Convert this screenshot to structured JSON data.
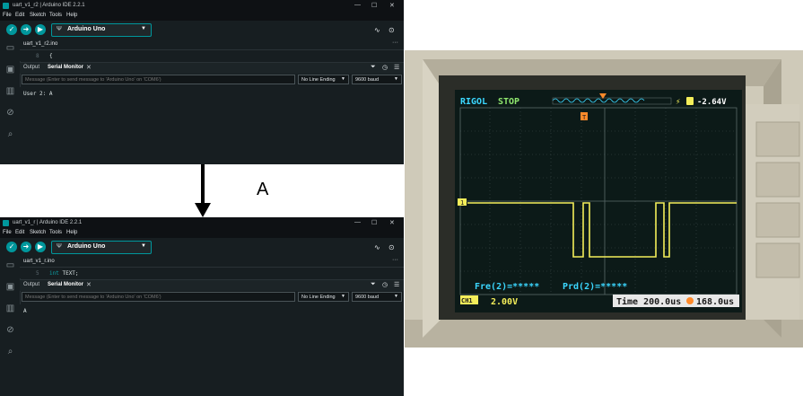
{
  "ide_top": {
    "title": "uart_v1_r2 | Arduino IDE 2.2.1",
    "menu": [
      "File",
      "Edit",
      "Sketch",
      "Tools",
      "Help"
    ],
    "board": "Arduino Uno",
    "file_tab": "uart_v1_r2.ino",
    "line_number": "8",
    "code": "{",
    "panel_tabs": [
      "Output",
      "Serial Monitor"
    ],
    "message_placeholder": "Message (Enter to send message to 'Arduino Uno' on 'COM6')",
    "line_ending": "No Line Ending",
    "baud": "9600 baud",
    "output": "User 2: A"
  },
  "ide_bottom": {
    "title": "uart_v1_r | Arduino IDE 2.2.1",
    "menu": [
      "File",
      "Edit",
      "Sketch",
      "Tools",
      "Help"
    ],
    "board": "Arduino Uno",
    "file_tab": "uart_v1_r.ino",
    "line_number": "5",
    "code_kw": "int",
    "code": "TEXT;",
    "panel_tabs": [
      "Output",
      "Serial Monitor"
    ],
    "message_placeholder": "Message (Enter to send message to 'Arduino Uno' on 'COM6')",
    "line_ending": "No Line Ending",
    "baud": "9600 baud",
    "output": "A"
  },
  "arrow_label": "A",
  "scope": {
    "brand": "RIGOL",
    "status": "STOP",
    "trigger_level": "-2.64V",
    "channel_marker": "1",
    "trigger_marker": "T",
    "freq": "Fre(2)=*****",
    "period": "Prd(2)=*****",
    "ch1_label": "CH1",
    "ch1_scale": "2.00V",
    "time_base": "Time 200.0us",
    "time_offset": "168.0us",
    "colors": {
      "trace": "#f4ee5a",
      "text_blue": "#3bd7ff",
      "text_green": "#8fe66e",
      "screen": "#0c1a18"
    }
  }
}
